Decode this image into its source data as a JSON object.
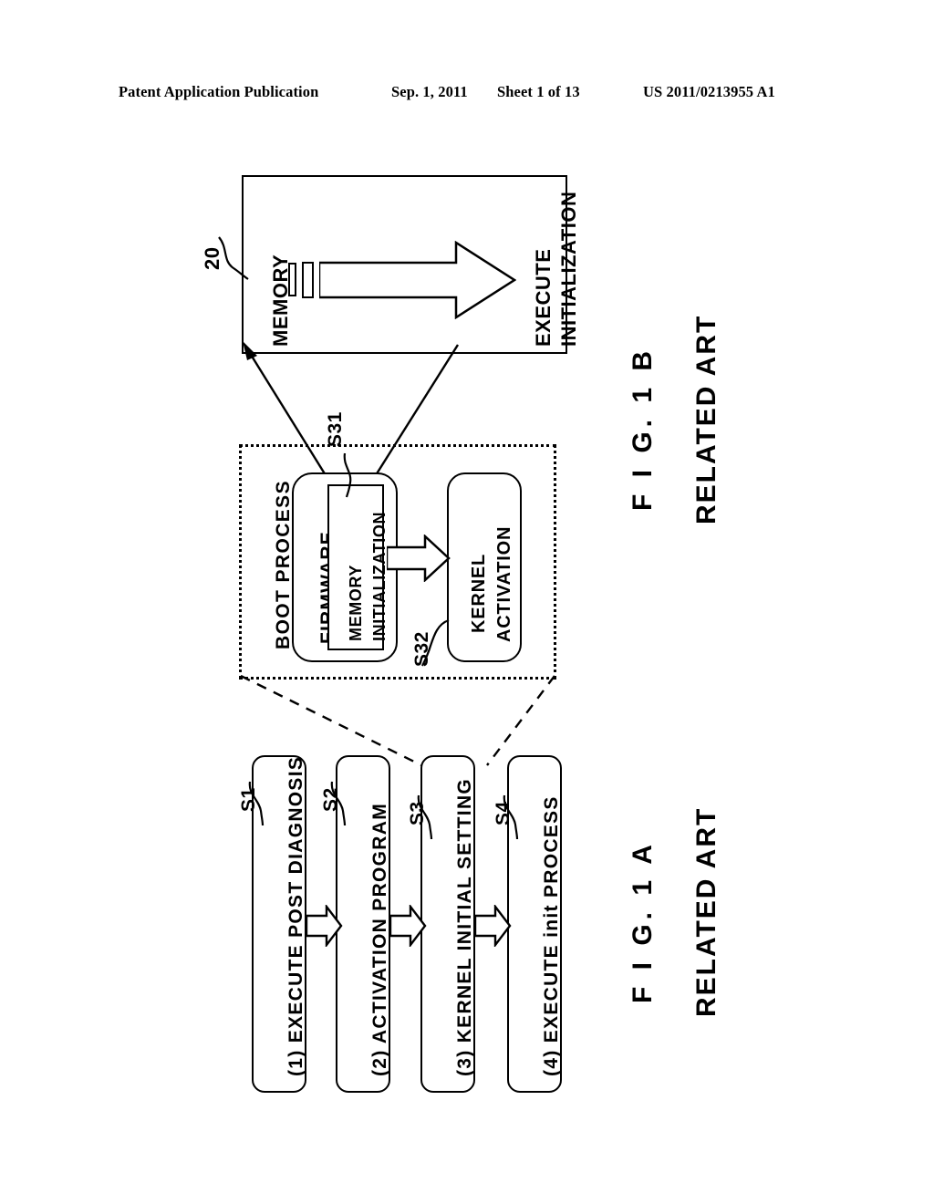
{
  "header": {
    "title": "Patent Application Publication",
    "date": "Sep. 1, 2011",
    "sheet": "Sheet 1 of 13",
    "publication_number": "US 2011/0213955 A1"
  },
  "fig1b": {
    "caption": "F I G.  1 B",
    "subcaption": "RELATED ART",
    "memory": {
      "ref": "20",
      "label": "MEMORY",
      "action_line1": "EXECUTE",
      "action_line2": "INITIALIZATION"
    },
    "boot_process": {
      "label": "BOOT PROCESS",
      "firmware": {
        "label": "FIRMWARE",
        "memory_initialization_line1": "MEMORY",
        "memory_initialization_line2": "INITIALIZATION",
        "ref": "S31"
      },
      "kernel_activation": {
        "label_line1": "KERNEL",
        "label_line2": "ACTIVATION",
        "ref": "S32"
      }
    }
  },
  "fig1a": {
    "caption": "F I G.  1 A",
    "subcaption": "RELATED ART",
    "steps": [
      {
        "ref": "S1",
        "label": "(1) EXECUTE POST DIAGNOSIS"
      },
      {
        "ref": "S2",
        "label": "(2) ACTIVATION PROGRAM"
      },
      {
        "ref": "S3",
        "label": "(3) KERNEL INITIAL SETTING"
      },
      {
        "ref": "S4",
        "label": "(4) EXECUTE init PROCESS"
      }
    ]
  },
  "colors": {
    "ink": "#000000",
    "paper": "#ffffff"
  }
}
